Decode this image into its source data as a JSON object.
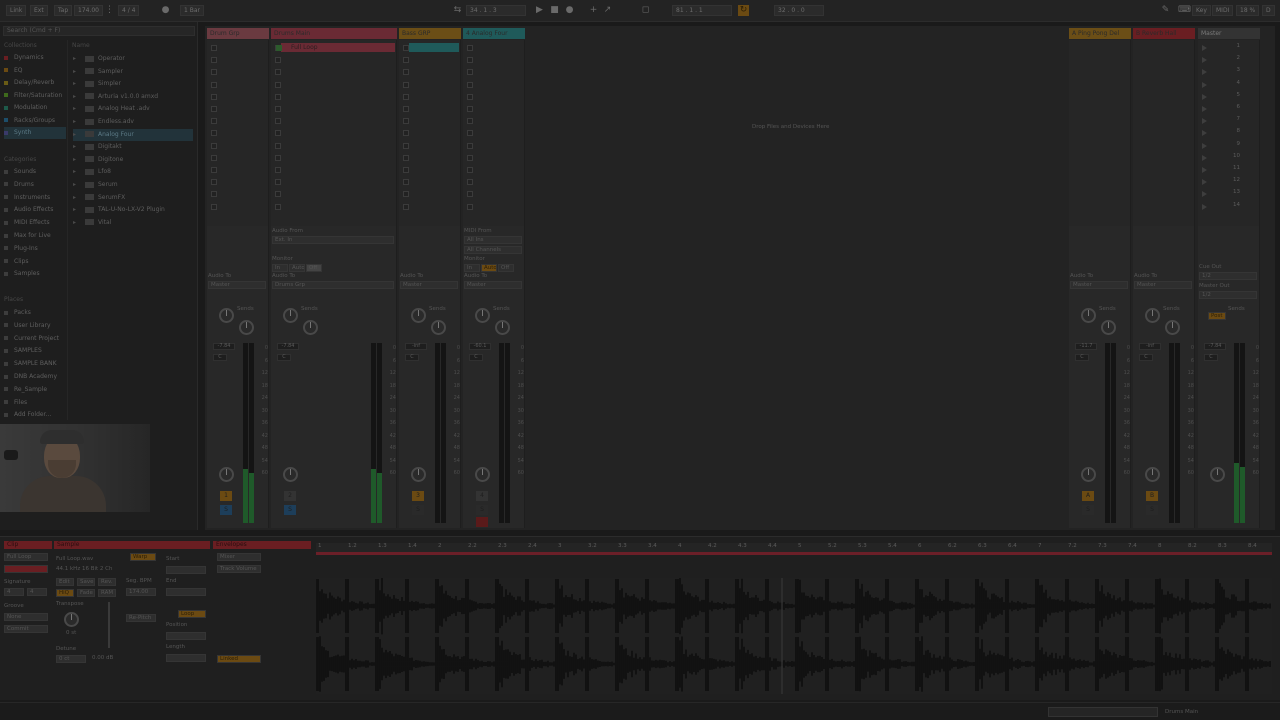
{
  "transport": {
    "link": "Link",
    "ext": "Ext",
    "tap": "Tap",
    "tempo": "174.00",
    "meter": "4 / 4",
    "bar": "1 Bar",
    "position": "34 . 1 . 3",
    "loop_start": "81 . 1 . 1",
    "loop_len": "32 . 0 . 0",
    "key": "Key",
    "midi": "MIDI",
    "cpu": "18 %",
    "hw": "D"
  },
  "browser": {
    "search_placeholder": "Search (Cmd + F)",
    "collections_header": "Collections",
    "name_header": "Name",
    "collections": [
      {
        "label": "Dynamics",
        "color": "#6a1e22"
      },
      {
        "label": "EQ",
        "color": "#6b4a12"
      },
      {
        "label": "Delay/Reverb",
        "color": "#6a5c16"
      },
      {
        "label": "Filter/Saturation",
        "color": "#3e6a1c"
      },
      {
        "label": "Modulation",
        "color": "#1e5a4a"
      },
      {
        "label": "Racks/Groups",
        "color": "#1d4e6a"
      },
      {
        "label": "Synth",
        "color": "#3a3a6a"
      }
    ],
    "categories_header": "Categories",
    "categories": [
      "Sounds",
      "Drums",
      "Instruments",
      "Audio Effects",
      "MIDI Effects",
      "Max for Live",
      "Plug-Ins",
      "Clips",
      "Samples"
    ],
    "places_header": "Places",
    "places": [
      "Packs",
      "User Library",
      "Current Project",
      "SAMPLES",
      "SAMPLE BANK",
      "DNB Academy",
      "Re_Sample",
      "Files",
      "Add Folder..."
    ],
    "items": [
      "Operator",
      "Sampler",
      "Simpler",
      "Arturia v1.0.0 amxd",
      "Analog Heat .adv",
      "Endless.adv",
      "Analog Four",
      "Digitakt",
      "Digitone",
      "Lfo8",
      "Serum",
      "SerumFX",
      "TAL-U-No-LX-V2 Plugin",
      "Vital"
    ],
    "selected_item": "Analog Four"
  },
  "session": {
    "drop_text": "Drop Files and Devices Here",
    "tracks": [
      {
        "name": "Drum Grp",
        "color": "#6a3a40"
      },
      {
        "name": "Drums Main",
        "color": "#6a2a34"
      },
      {
        "name": "Bass GRP",
        "color": "#6b4e16"
      },
      {
        "name": "4 Analog Four",
        "color": "#1f5a5a"
      }
    ],
    "returns": [
      {
        "name": "A Ping Pong Del",
        "color": "#6b4e16"
      },
      {
        "name": "B Reverb Hall",
        "color": "#6a1e22"
      }
    ],
    "master": {
      "name": "Master",
      "color": "#333333"
    },
    "clip_name": "Full Loop",
    "io": {
      "audio_from": "Audio From",
      "ext_in": "Ext. In",
      "monitor": "Monitor",
      "audio_to": "Audio To",
      "master": "Master",
      "drums_grp": "Drums Grp",
      "midi_from": "MIDI From",
      "all_ins": "All Ins",
      "all_channels": "All Channels",
      "cue_out": "Cue Out",
      "master_out": "Master Out",
      "out_12": "1/2",
      "in": "In",
      "auto": "Auto",
      "off": "Off",
      "sends": "Sends",
      "post": "Post"
    },
    "volumes": [
      "-7.84",
      "-7.84",
      "-inf",
      "-60.1",
      "-11.7",
      "-inf",
      "-7.84"
    ],
    "track_numbers": [
      "1",
      "2",
      "3",
      "4",
      "A",
      "B"
    ],
    "scale": [
      "0",
      "6",
      "12",
      "18",
      "24",
      "30",
      "36",
      "42",
      "48",
      "54",
      "60"
    ],
    "scenes": [
      "1",
      "2",
      "3",
      "4",
      "5",
      "6",
      "7",
      "8",
      "9",
      "10",
      "11",
      "12",
      "13",
      "14"
    ]
  },
  "detail": {
    "clip_label": "Clip",
    "sample_label": "Sample",
    "env_label": "Envelopes",
    "clip_name": "Full Loop",
    "sample_name": "Full Loop.wav",
    "sample_info": "44.1 kHz 16 Bit 2 Ch",
    "warp": "Warp",
    "start": "Start",
    "end": "End",
    "seg_bpm": "Seg. BPM",
    "bpm_value": "174.00",
    "loop": "Loop",
    "position": "Position",
    "length": "Length",
    "signature": "Signature",
    "sig_num": "4",
    "sig_den": "4",
    "groove": "Groove",
    "none": "None",
    "commit": "Commit",
    "hiq": "HiQ",
    "fade": "Fade",
    "ram": "RAM",
    "edit": "Edit",
    "save": "Save",
    "rev": "Rev.",
    "transpose": "Transpose",
    "detune": "Detune",
    "semitones": "0 st",
    "cents": "0 ct",
    "gain": "0.00 dB",
    "beats": "Re-Pitch",
    "mixer_in": "Mixer",
    "track_vol": "Track Volume",
    "linked": "Linked",
    "ruler": [
      "1",
      "1.2",
      "1.3",
      "1.4",
      "2",
      "2.2",
      "2.3",
      "2.4",
      "3",
      "3.2",
      "3.3",
      "3.4",
      "4",
      "4.2",
      "4.3",
      "4.4",
      "5",
      "5.2",
      "5.3",
      "5.4",
      "6",
      "6.2",
      "6.3",
      "6.4",
      "7",
      "7.2",
      "7.3",
      "7.4",
      "8",
      "8.2",
      "8.3",
      "8.4"
    ]
  },
  "status": {
    "track": "Drums Main"
  }
}
